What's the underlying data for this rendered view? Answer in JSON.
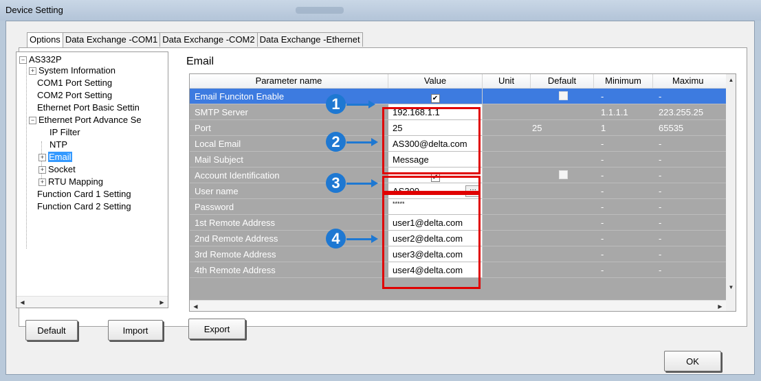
{
  "window": {
    "title": "Device Setting"
  },
  "tabs": [
    "Options",
    "Data Exchange -COM1",
    "Data Exchange -COM2",
    "Data Exchange -Ethernet"
  ],
  "tree": {
    "root": "AS332P",
    "items": [
      {
        "label": "System Information",
        "expander": "+"
      },
      {
        "label": "COM1 Port Setting"
      },
      {
        "label": "COM2 Port Setting"
      },
      {
        "label": "Ethernet Port Basic Settin"
      },
      {
        "label": "Ethernet Port Advance Se",
        "expander": "-"
      },
      {
        "label": "IP Filter"
      },
      {
        "label": "NTP"
      },
      {
        "label": "Email",
        "expander": "+",
        "selected": true
      },
      {
        "label": "Socket",
        "expander": "+"
      },
      {
        "label": "RTU Mapping",
        "expander": "+"
      },
      {
        "label": "Function Card 1 Setting"
      },
      {
        "label": "Function Card 2 Setting"
      }
    ]
  },
  "section_title": "Email",
  "grid": {
    "headers": [
      "Parameter name",
      "Value",
      "Unit",
      "Default",
      "Minimum",
      "Maximu"
    ],
    "rows": [
      {
        "name": "Email Funciton Enable",
        "value_check": "✔",
        "unit": "",
        "default_check": "",
        "min": "-",
        "max": "-"
      },
      {
        "name": "SMTP Server",
        "value": "192.168.1.1",
        "unit": "",
        "default": "",
        "min": "1.1.1.1",
        "max": "223.255.25"
      },
      {
        "name": "Port",
        "value": "25",
        "unit": "",
        "default": "25",
        "min": "1",
        "max": "65535"
      },
      {
        "name": "Local Email",
        "value": "AS300@delta.com",
        "unit": "",
        "default": "",
        "min": "-",
        "max": "-"
      },
      {
        "name": "Mail Subject",
        "value": "Message",
        "unit": "",
        "default": "",
        "min": "-",
        "max": "-"
      },
      {
        "name": "Account Identification",
        "value_check": "✔",
        "unit": "",
        "default_check": "",
        "min": "-",
        "max": "-"
      },
      {
        "name": "User name",
        "value": "AS300",
        "unit": "",
        "default": "",
        "min": "-",
        "max": "-",
        "button": "···"
      },
      {
        "name": "Password",
        "value": "*****",
        "unit": "",
        "default": "",
        "min": "-",
        "max": "-"
      },
      {
        "name": "1st Remote Address",
        "value": "user1@delta.com",
        "unit": "",
        "default": "",
        "min": "-",
        "max": "-"
      },
      {
        "name": "2nd Remote Address",
        "value": "user2@delta.com",
        "unit": "",
        "default": "",
        "min": "-",
        "max": "-"
      },
      {
        "name": "3rd Remote Address",
        "value": "user3@delta.com",
        "unit": "",
        "default": "",
        "min": "-",
        "max": "-"
      },
      {
        "name": "4th Remote Address",
        "value": "user4@delta.com",
        "unit": "",
        "default": "",
        "min": "-",
        "max": "-"
      }
    ]
  },
  "callouts": [
    "1",
    "2",
    "3",
    "4"
  ],
  "buttons": {
    "default": "Default",
    "import": "Import",
    "export": "Export",
    "ok": "OK"
  },
  "colors": {
    "selection": "#3d7be0",
    "callout": "#1e78d2",
    "highlight_box": "#e00000",
    "grid_bg": "#a8a8a8"
  }
}
